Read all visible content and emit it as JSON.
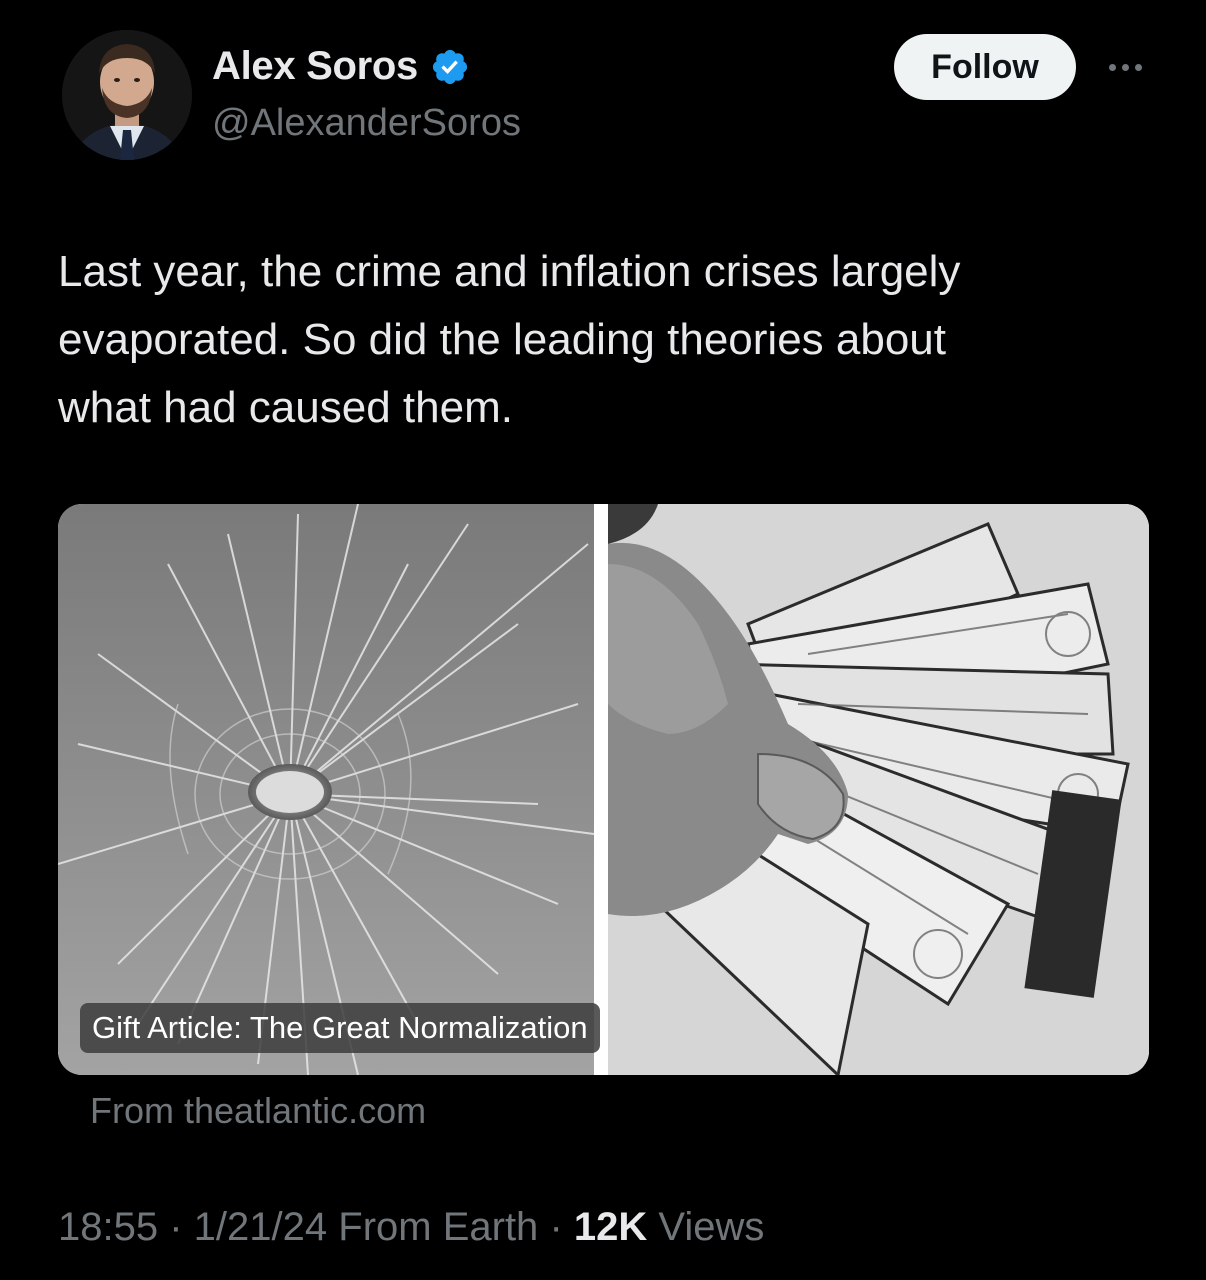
{
  "author": {
    "name": "Alex Soros",
    "handle": "@AlexanderSoros",
    "verified": true
  },
  "actions": {
    "follow_label": "Follow",
    "more_icon": "more-horizontal-icon"
  },
  "tweet": {
    "text": "Last year, the crime and inflation crises largely\nevaporated. So did the leading theories about\nwhat had caused them."
  },
  "card": {
    "caption": "Gift Article: The Great Normalization",
    "source": "From theatlantic.com",
    "images": [
      "shattered-glass-bullet-hole",
      "hand-holding-dollar-bills"
    ]
  },
  "meta": {
    "time": "18:55",
    "date": "1/21/24",
    "client": "From Earth",
    "views_count": "12K",
    "views_label": "Views"
  },
  "colors": {
    "background": "#000000",
    "text_primary": "#e7e9ea",
    "text_secondary": "#71767b",
    "verified_blue": "#1d9bf0",
    "follow_bg": "#eff3f4"
  }
}
